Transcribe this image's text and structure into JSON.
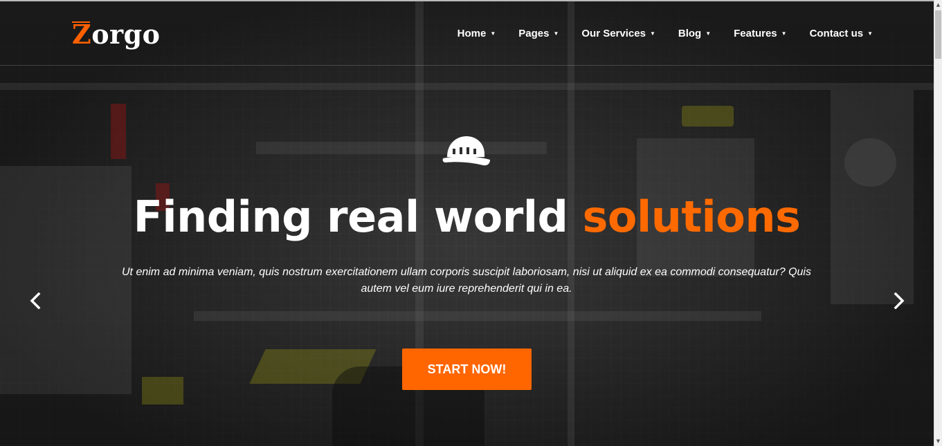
{
  "brand": {
    "logo_first": "Z",
    "logo_rest": "orgo"
  },
  "nav": [
    {
      "label": "Home"
    },
    {
      "label": "Pages"
    },
    {
      "label": "Our Services"
    },
    {
      "label": "Blog"
    },
    {
      "label": "Features"
    },
    {
      "label": "Contact us"
    }
  ],
  "hero": {
    "icon": "hard-hat-icon",
    "headline_main": "Finding real world ",
    "headline_accent": "solutions",
    "subtext": "Ut enim ad minima veniam, quis nostrum exercitationem ullam corporis suscipit laboriosam, nisi ut aliquid ex ea commodi consequatur? Quis autem vel eum iure reprehenderit qui in ea.",
    "cta_label": "START NOW!"
  },
  "colors": {
    "accent": "#ff6600",
    "text": "#ffffff",
    "overlay": "#2b2b2b"
  }
}
